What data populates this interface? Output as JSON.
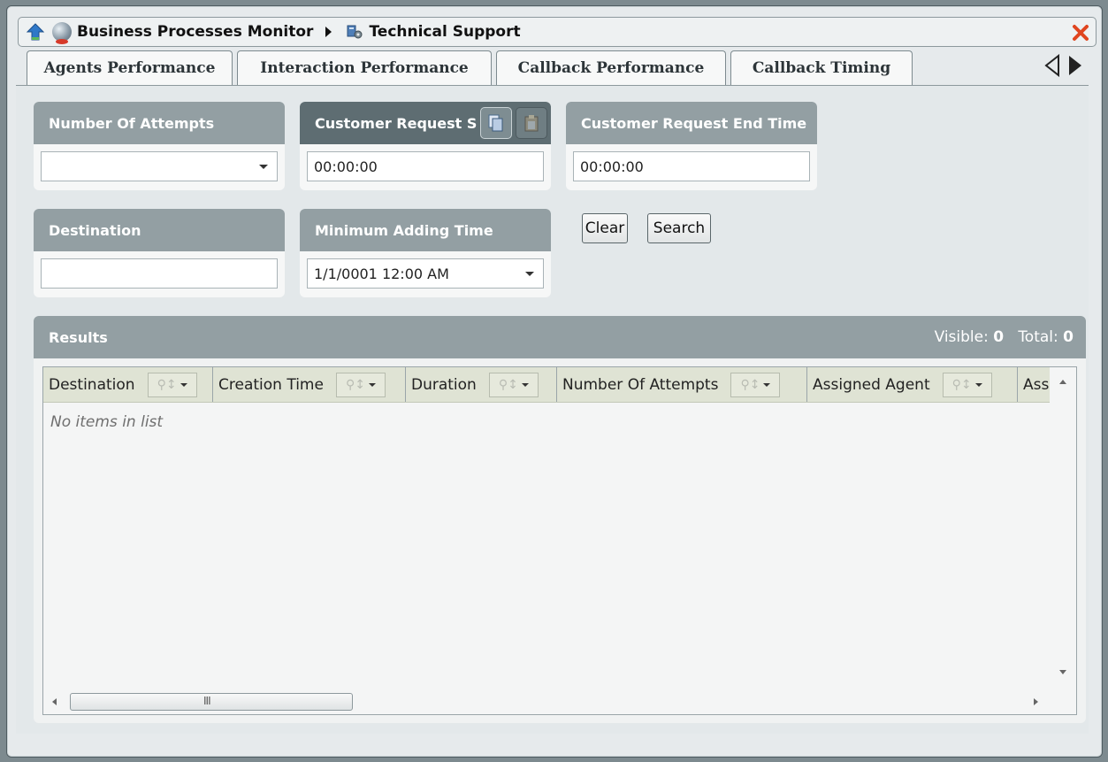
{
  "window": {
    "breadcrumb_root": "Business Processes Monitor",
    "breadcrumb_current": "Technical Support"
  },
  "tabs": [
    {
      "label": "Agents Performance"
    },
    {
      "label": "Interaction Performance"
    },
    {
      "label": "Callback Performance"
    },
    {
      "label": "Callback Timing"
    }
  ],
  "filters": {
    "number_of_attempts": {
      "label": "Number Of Attempts",
      "value": ""
    },
    "request_start": {
      "label": "Customer Request S",
      "value": "00:00:00"
    },
    "request_end": {
      "label": "Customer Request End Time",
      "value": "00:00:00"
    },
    "destination": {
      "label": "Destination",
      "value": ""
    },
    "min_adding_time": {
      "label": "Minimum Adding Time",
      "value": "1/1/0001 12:00 AM"
    }
  },
  "buttons": {
    "clear": "Clear",
    "search": "Search"
  },
  "results": {
    "title": "Results",
    "visible_label": "Visible:",
    "visible_count": "0",
    "total_label": "Total:",
    "total_count": "0",
    "columns": [
      "Destination",
      "Creation Time",
      "Duration",
      "Number Of Attempts",
      "Assigned Agent",
      "Ass"
    ],
    "empty_text": "No items in list",
    "scroll_grip": "III"
  },
  "colors": {
    "header_gray": "#939fa3",
    "header_dark": "#5e6d72",
    "close_red": "#e0451f",
    "home_blue": "#2f78c8"
  }
}
